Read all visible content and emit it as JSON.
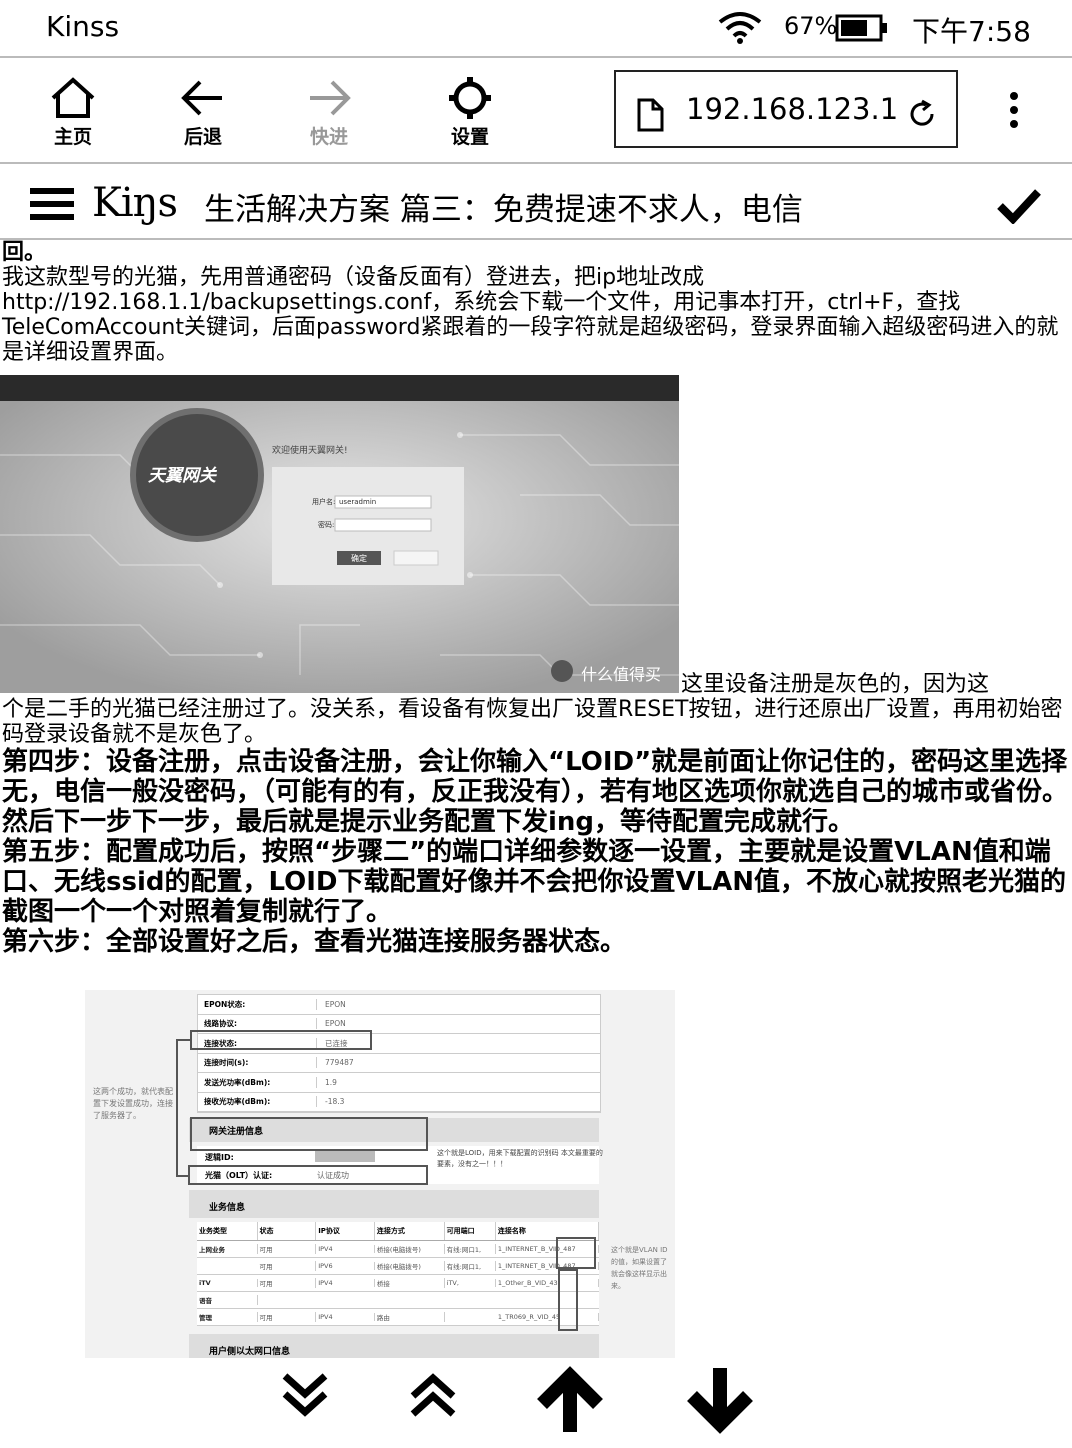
{
  "status": {
    "app_name": "Kinss",
    "battery": "67%",
    "time": "下午7:58"
  },
  "toolbar": {
    "home_label": "主页",
    "back_label": "后退",
    "forward_label": "快进",
    "settings_label": "设置",
    "url": "192.168.123.1"
  },
  "titlebar": {
    "logo": "Kiŋs",
    "title": "生活解决方案 篇三：免费提速不求人，电信"
  },
  "content": {
    "p0": "回。",
    "p1": "我这款型号的光猫，先用普通密码（设备反面有）登进去，把ip地址改成http://192.168.1.1/backupsettings.conf，系统会下载一个文件，用记事本打开，ctrl+F，查找TeleComAccount关键词，后面password紧跟着的一段字符就是超级密码，登录界面输入超级密码进入的就是详细设置界面。",
    "img1": {
      "welcome": "欢迎使用天翼网关!",
      "brand": "天翼网关",
      "user_label": "用户名:",
      "user_value": "useradmin",
      "pwd_label": "密码:",
      "login_btn": "确定",
      "watermark": "什么值得买"
    },
    "p2_inline": "这里设备注册是灰色的，因为这",
    "p2_rest": "个是二手的光猫已经注册过了。没关系，看设备有恢复出厂设置RESET按钮，进行还原出厂设置，再用初始密码登录设备就不是灰色了。",
    "step4": "第四步：设备注册，点击设备注册，会让你输入“LOID”就是前面让你记住的，密码这里选择无，电信一般没密码，（可能有的有，反正我没有），若有地区选项你就选自己的城市或省份。然后下一步下一步，最后就是提示业务配置下发ing，等待配置完成就行。",
    "step5": "第五步：配置成功后，按照“步骤二”的端口详细参数逐一设置，主要就是设置VLAN值和端口、无线ssid的配置，LOID下载配置好像并不会把你设置VLAN值，不放心就按照老光猫的截图一个一个对照着复制就行了。",
    "step6": "第六步：全部设置好之后，查看光猫连接服务器状态。",
    "img2": {
      "left_note": "这两个成功，就代表配置下发设置成功，连接了服务器了。",
      "rows": [
        {
          "k": "EPON状态:",
          "v": "EPON"
        },
        {
          "k": "线路协议:",
          "v": "EPON"
        },
        {
          "k": "连接状态:",
          "v": "已连接"
        },
        {
          "k": "连接时间(s):",
          "v": "779487"
        },
        {
          "k": "发送光功率(dBm):",
          "v": "1.9"
        },
        {
          "k": "接收光功率(dBm):",
          "v": "-18.3"
        }
      ],
      "gw_header": "网关注册信息",
      "loid_label": "逻辑ID:",
      "loid_note": "这个就是LOID，用来下载配置的识别码 本文最重要的要素，没有之一！！！",
      "olt_label": "光猫（OLT）认证:",
      "olt_value": "认证成功",
      "biz_header": "业务信息",
      "biz_cols": [
        "业务类型",
        "状态",
        "IP协议",
        "连接方式",
        "可用端口",
        "连接名称"
      ],
      "biz_rows": [
        [
          "上网业务",
          "可用",
          "IPV4",
          "桥接(电脑拨号)",
          "有线:网口1,",
          "1_INTERNET_B_VID_487"
        ],
        [
          "",
          "可用",
          "IPV6",
          "桥接(电脑拨号)",
          "有线:网口1,",
          "1_INTERNET_B_VID_487"
        ],
        [
          "iTV",
          "可用",
          "IPV4",
          "桥接",
          "iTV,",
          "1_Other_B_VID_43"
        ],
        [
          "语音",
          "",
          "",
          "",
          "",
          ""
        ],
        [
          "管理",
          "可用",
          "IPV4",
          "路由",
          "",
          "1_TR069_R_VID_45"
        ]
      ],
      "right_note": "这个就是VLAN ID的值，如果设置了就会像这样显示出来。",
      "lan_header": "用户侧以太网口信息"
    }
  }
}
